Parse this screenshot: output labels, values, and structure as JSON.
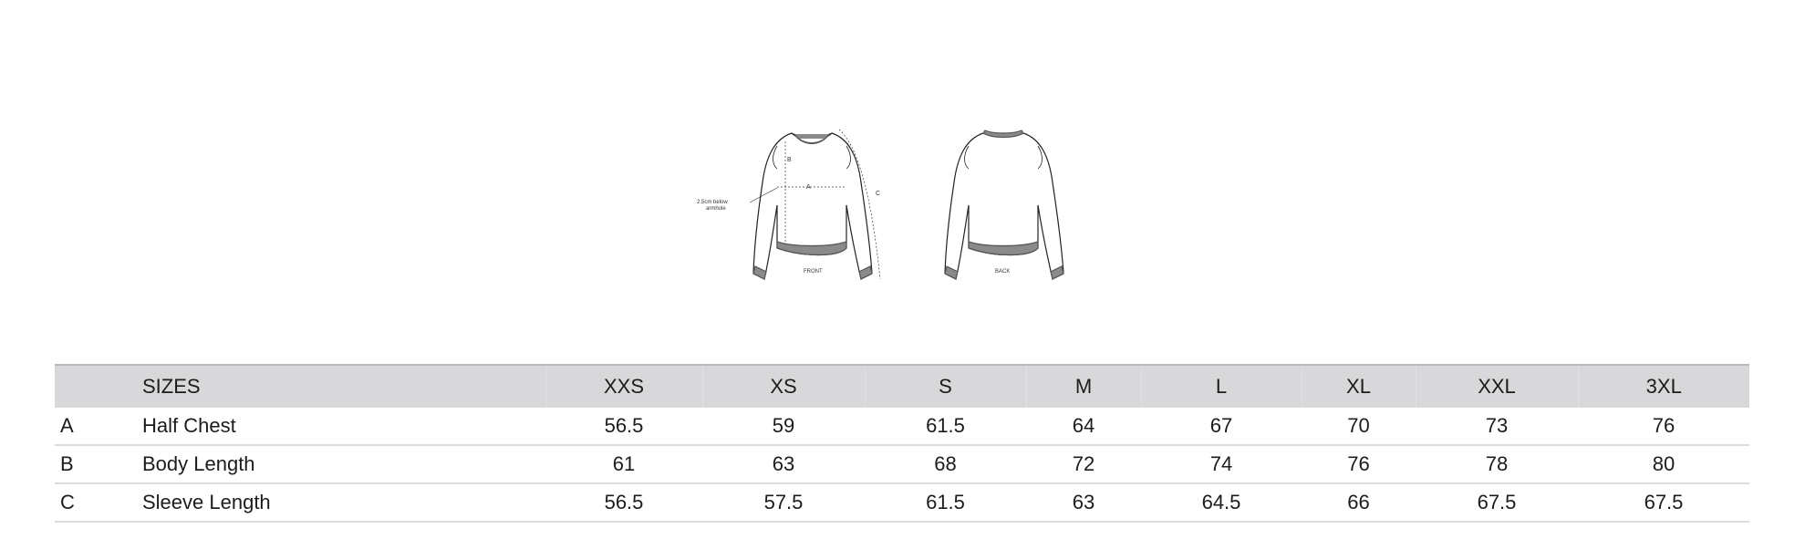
{
  "figure": {
    "front_label": "FRONT",
    "back_label": "BACK",
    "marker_a": "A",
    "marker_b": "B",
    "marker_c": "C",
    "note_line1": "2.5cm below",
    "note_line2": "armhole"
  },
  "table": {
    "header_label": "SIZES",
    "sizes": [
      "XXS",
      "XS",
      "S",
      "M",
      "L",
      "XL",
      "XXL",
      "3XL"
    ],
    "rows": [
      {
        "code": "A",
        "name": "Half Chest",
        "values": [
          "56.5",
          "59",
          "61.5",
          "64",
          "67",
          "70",
          "73",
          "76"
        ]
      },
      {
        "code": "B",
        "name": "Body Length",
        "values": [
          "61",
          "63",
          "68",
          "72",
          "74",
          "76",
          "78",
          "80"
        ]
      },
      {
        "code": "C",
        "name": "Sleeve Length",
        "values": [
          "56.5",
          "57.5",
          "61.5",
          "63",
          "64.5",
          "66",
          "67.5",
          "67.5"
        ]
      }
    ]
  },
  "colors": {
    "header_bg": "#d8d8da",
    "rib": "#8a8a8a"
  }
}
